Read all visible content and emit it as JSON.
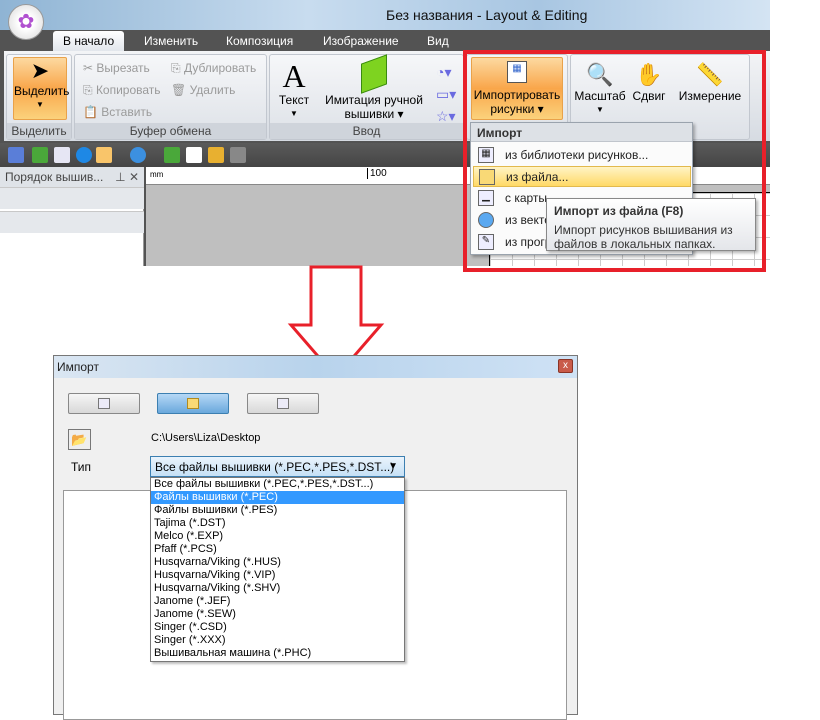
{
  "window": {
    "title": "Без названия - Layout & Editing"
  },
  "tabs": [
    "В начало",
    "Изменить",
    "Композиция",
    "Изображение",
    "Вид"
  ],
  "ribbon": {
    "select": {
      "label": "Выделить",
      "group": "Выделить"
    },
    "clipboard": {
      "group": "Буфер обмена",
      "cut": "Вырезать",
      "copy": "Копировать",
      "paste": "Вставить",
      "duplicate": "Дублировать",
      "delete": "Удалить"
    },
    "input": {
      "group": "Ввод",
      "text": "Текст",
      "hand1": "Имитация ручной",
      "hand2": "вышивки"
    },
    "import": {
      "label1": "Импортировать",
      "label2": "рисунки"
    },
    "zoom": "Масштаб",
    "pan": "Сдвиг",
    "measure": "Измерение"
  },
  "panel": {
    "title": "Порядок вышив..."
  },
  "ruler": {
    "unit": "mm",
    "mark": "100"
  },
  "import_menu": {
    "header": "Импорт",
    "items": [
      "из библиотеки рисунков...",
      "из файла...",
      "с карты...",
      "из векто",
      "из прогр"
    ]
  },
  "tooltip": {
    "title": "Импорт из файла (F8)",
    "line1": "Импорт рисунков вышивания из",
    "line2": "файлов в локальных папках."
  },
  "dialog": {
    "title": "Импорт",
    "close": "x",
    "path": "C:\\Users\\Liza\\Desktop",
    "type_label": "Тип",
    "type_value": "Все файлы вышивки (*.PEC,*.PES,*.DST...)",
    "options": [
      "Все файлы вышивки (*.PEC,*.PES,*.DST...)",
      "Файлы вышивки (*.PEC)",
      "Файлы вышивки (*.PES)",
      "Tajima (*.DST)",
      "Melco (*.EXP)",
      "Pfaff (*.PCS)",
      "Husqvarna/Viking (*.HUS)",
      "Husqvarna/Viking (*.VIP)",
      "Husqvarna/Viking (*.SHV)",
      "Janome (*.JEF)",
      "Janome (*.SEW)",
      "Singer (*.CSD)",
      "Singer (*.XXX)",
      "Вышивальная машина (*.PHC)"
    ],
    "highlighted_option": 1
  },
  "colors": {
    "highlight": "#e8202a",
    "select": "#3399ff"
  }
}
